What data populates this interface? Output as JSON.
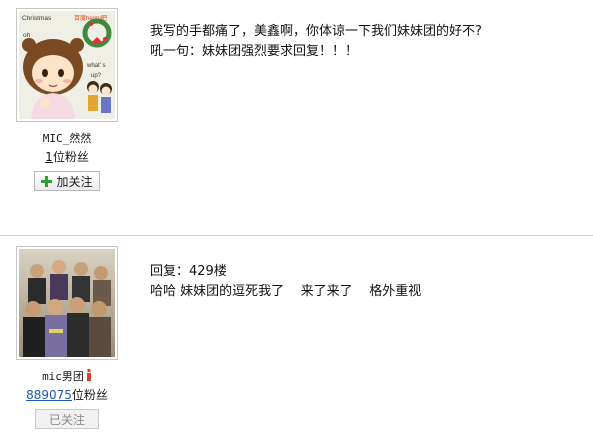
{
  "posts": [
    {
      "user": {
        "name": "MIC_然然",
        "fans_count": "1",
        "fans_suffix": "位粉丝",
        "follow_label": "加关注",
        "avatar_text": {
          "christmas": "Christmas",
          "oh": "oh",
          "watermark": "百度henry吧",
          "whats": "what' s",
          "up": "up?"
        }
      },
      "content": {
        "line1": "我写的手都痛了，美鑫啊，你体谅一下我们妹妹团的好不?",
        "line2": "吼一句：妹妹团强烈要求回复！！！"
      }
    },
    {
      "user": {
        "name": "mic男团",
        "fans_count": "889075",
        "fans_suffix": "位粉丝",
        "follow_label": "已关注"
      },
      "content": {
        "line1": "回复：429楼",
        "line2": "哈哈 妹妹团的逗死我了    来了来了    格外重视"
      }
    }
  ],
  "colors": {
    "follow_plus": "#2e9e2e",
    "fans_link": "#1a56b8",
    "vip_badge": "#d9421c"
  },
  "icons": [
    "plus-icon",
    "vip-badge-icon"
  ]
}
